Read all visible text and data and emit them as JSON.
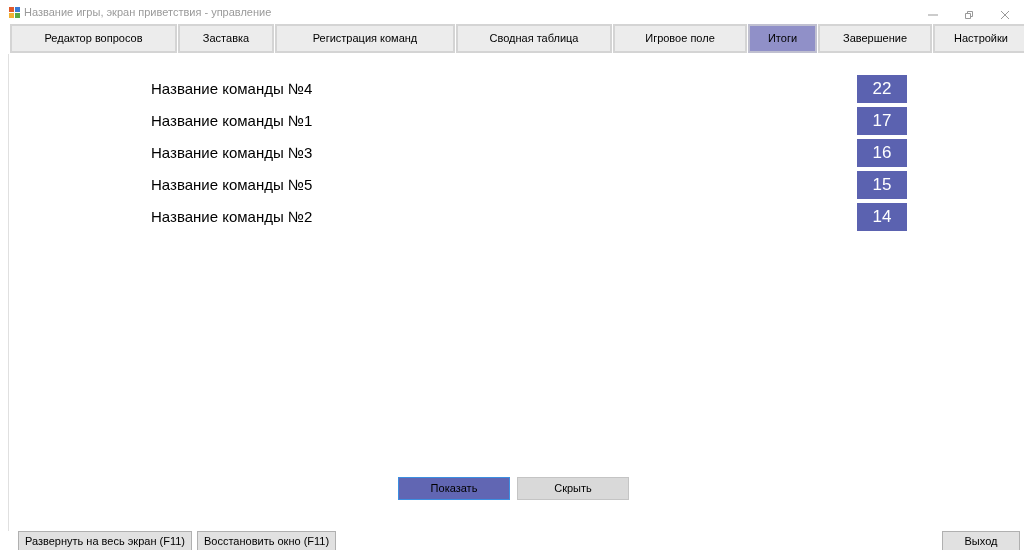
{
  "window": {
    "title": "Название игры, экран приветствия - управление"
  },
  "tabs": [
    {
      "label": "Редактор вопросов",
      "selected": false
    },
    {
      "label": "Заставка",
      "selected": false
    },
    {
      "label": "Регистрация команд",
      "selected": false
    },
    {
      "label": "Сводная таблица",
      "selected": false
    },
    {
      "label": "Игровое поле",
      "selected": false
    },
    {
      "label": "Итоги",
      "selected": true
    },
    {
      "label": "Завершение",
      "selected": false
    },
    {
      "label": "Настройки",
      "selected": false
    }
  ],
  "results": [
    {
      "team": "Название команды №4",
      "score": "22"
    },
    {
      "team": "Название команды №1",
      "score": "17"
    },
    {
      "team": "Название команды №3",
      "score": "16"
    },
    {
      "team": "Название команды №5",
      "score": "15"
    },
    {
      "team": "Название команды №2",
      "score": "14"
    }
  ],
  "actions": [
    {
      "label": "Показать",
      "focused": true
    },
    {
      "label": "Скрыть",
      "focused": false
    }
  ],
  "footer": {
    "left": [
      "Развернуть на весь экран (F11)",
      "Восстановить окно (F11)"
    ],
    "right": "Выход"
  }
}
